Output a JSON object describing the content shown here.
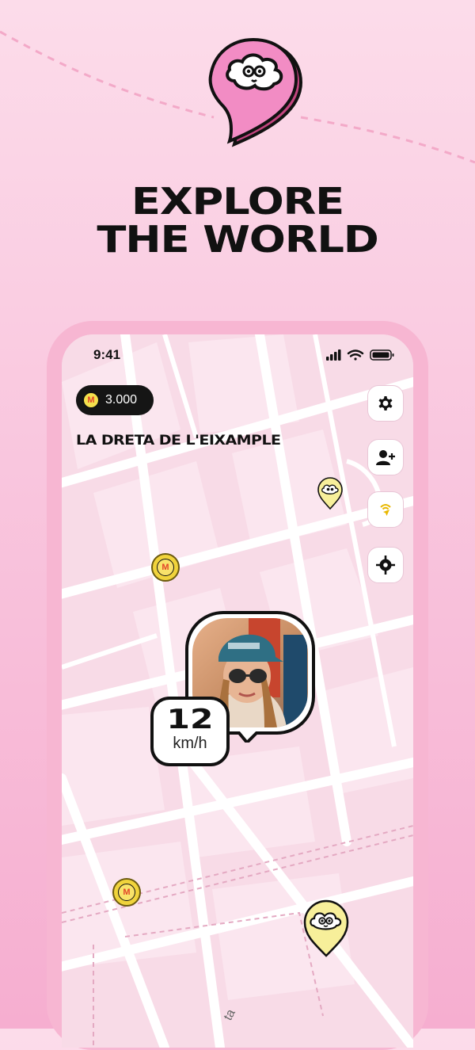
{
  "headline": {
    "line1": "EXPLORE",
    "line2": "THE WORLD"
  },
  "status_bar": {
    "time": "9:41"
  },
  "coins": {
    "balance": "3.000",
    "symbol": "M"
  },
  "district": {
    "name": "LA DRETA DE  L'EIXAMPLE"
  },
  "speed": {
    "value": "12",
    "unit": "km/h"
  },
  "street_fragment": "ta",
  "side_buttons": [
    "gear-icon",
    "add-user-icon",
    "share-location-icon",
    "locate-icon"
  ],
  "colors": {
    "accent_pink": "#f28cc4",
    "coin_yellow": "#f4e04d",
    "map_bg": "#f8dbe7",
    "ink": "#111111"
  }
}
